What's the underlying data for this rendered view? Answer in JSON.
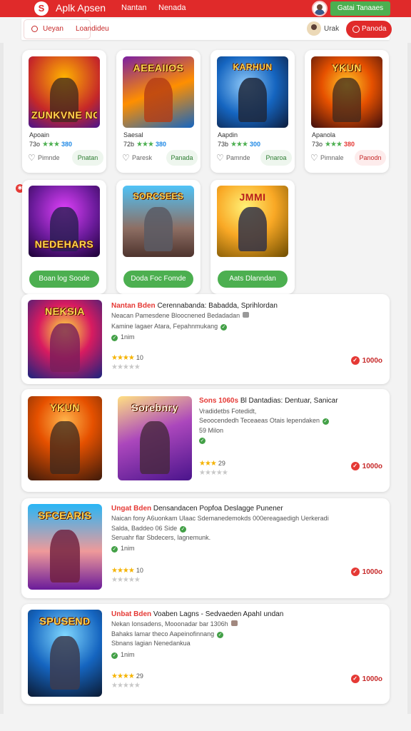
{
  "header": {
    "logo_glyph": "S",
    "title": "Aplk Apsen",
    "nav": [
      "Nantan",
      "Nenada"
    ],
    "action_button": "Gatai Tanaaes"
  },
  "subbar": {
    "tabs": [
      "Ueyan",
      "Loandideu"
    ],
    "user_name": "Urak",
    "action_button": "Panoda"
  },
  "featured_cards": [
    {
      "art": "ZUNKVNE NODK",
      "name": "Apoain",
      "version": "73o",
      "stars": "★★★",
      "count": "380",
      "count_color": "#1e88e5",
      "fav_label": "Pimnde",
      "action": "Pnatan",
      "action_color": "green"
    },
    {
      "art": "AEEAIIOS",
      "name": "Saesal",
      "version": "72b",
      "stars": "★★★",
      "count": "380",
      "count_color": "#1e88e5",
      "fav_label": "Paresk",
      "action": "Panada",
      "action_color": "green"
    },
    {
      "art": "KARHUN",
      "name": "Aapdin",
      "version": "73b",
      "stars": "★★★",
      "count": "300",
      "count_color": "#1e88e5",
      "fav_label": "Pamnde",
      "action": "Pnaroa",
      "action_color": "green"
    },
    {
      "art": "YKUN",
      "name": "Apanola",
      "version": "73o",
      "stars": "★★★",
      "count": "380",
      "count_color": "#e53935",
      "fav_label": "Pimnale",
      "action": "Panodn",
      "action_color": "red"
    }
  ],
  "secondary_cards": [
    {
      "art": "NEDEHARS",
      "action": "Boan log Soode"
    },
    {
      "art": "SORCSEES",
      "action": "Doda Foc Fomde"
    },
    {
      "art": "JMMI",
      "action": "Aats Dlanndan"
    }
  ],
  "entries": [
    {
      "highlight": "Nantan Bden",
      "title": "Cerennabanda: Babadda, Sprihlordan",
      "lines": [
        "Neacan Pamesdene Bloocnened Bedadadan",
        "Kamine lagaer Atara, Fepahnmukang",
        "1nim"
      ],
      "rating": "10",
      "price": "1000o",
      "arts": [
        "NEKSIA"
      ]
    },
    {
      "highlight": "Sons 1060s",
      "title": "Bl Dantadias: Dentuar, Sanicar",
      "lines": [
        "Vradidetbs Fotedidt,",
        "Seoocendedh Teceaeas Otais lependaken",
        "59 Milon"
      ],
      "rating": "29",
      "price": "1000o",
      "arts": [
        "YKUN",
        "Sorebnry"
      ]
    },
    {
      "highlight": "Ungat Bden",
      "title": "Densandacen Popfoa Deslagge Punener",
      "lines": [
        "Naican fony A6uonkam Ulaac Sdemanedemokds 000ereagaedigh Uerkeradi",
        "Salda, Baddeo 06 Side",
        "Seruahr flar Sbdecers, lagnemunk.",
        "1nim"
      ],
      "rating": "10",
      "price": "1000o",
      "arts": [
        "SFCEARIS"
      ]
    },
    {
      "highlight": "Unbat Bden",
      "title": "Voaben Lagns - Sedvaeden ApahI undan",
      "lines": [
        "Nekan Ionsadens, Mooonadar bar 1306h",
        "Bahaks lamar theco Aapeinofinnang",
        "Sbnans lagian Nenedankua",
        "1nim"
      ],
      "rating": "29",
      "price": "1000o",
      "arts": [
        "SPUSEND"
      ]
    }
  ]
}
